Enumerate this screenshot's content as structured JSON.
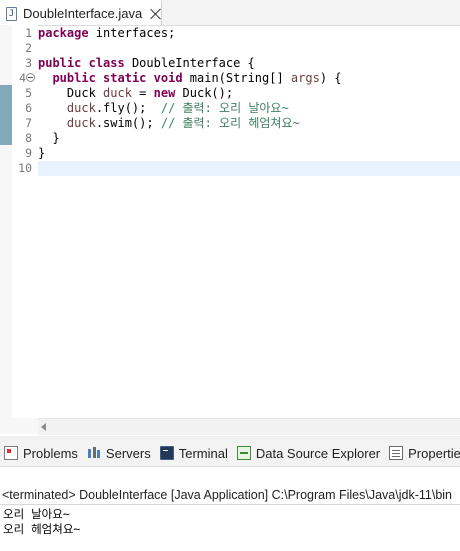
{
  "editor": {
    "tab": {
      "icon": "java-file-icon",
      "icon_glyph": "J",
      "title": "DoubleInterface.java"
    },
    "line_numbers": [
      "1",
      "2",
      "3",
      "4",
      "5",
      "6",
      "7",
      "8",
      "9",
      "10"
    ],
    "folded_marker_line": "4",
    "code": {
      "l1_kw": "package",
      "l1_rest": " interfaces;",
      "l3_kw1": "public",
      "l3_kw2": "class",
      "l3_rest": " DoubleInterface {",
      "l4_kw1": "public",
      "l4_kw2": "static",
      "l4_kw3": "void",
      "l4_mid": " main(String[] ",
      "l4_param": "args",
      "l4_end": ") {",
      "l5_type": "Duck ",
      "l5_var": "duck",
      "l5_eq": " = ",
      "l5_kw": "new",
      "l5_rest": " Duck();",
      "l6_var": "duck",
      "l6_rest": ".fly();  ",
      "l6_comment": "// 출력: 오리 날아요~",
      "l7_var": "duck",
      "l7_rest": ".swim(); ",
      "l7_comment": "// 출력: 오리 헤엄쳐요~",
      "l8": "}",
      "l9": "}"
    }
  },
  "bottom_panel": {
    "tabs": [
      {
        "label": "Problems",
        "icon": "problems-icon"
      },
      {
        "label": "Servers",
        "icon": "servers-icon"
      },
      {
        "label": "Terminal",
        "icon": "terminal-icon"
      },
      {
        "label": "Data Source Explorer",
        "icon": "data-source-explorer-icon"
      },
      {
        "label": "Properties",
        "icon": "properties-icon"
      }
    ],
    "console": {
      "header": "<terminated> DoubleInterface [Java Application] C:\\Program Files\\Java\\jdk-11\\bin",
      "output": [
        "오리 날아요~",
        "오리 헤엄쳐요~"
      ]
    }
  },
  "colors": {
    "keyword": "#7f0055",
    "comment": "#3f7f5f",
    "variable": "#6a3e3e",
    "current_line": "#e8f2fe"
  }
}
